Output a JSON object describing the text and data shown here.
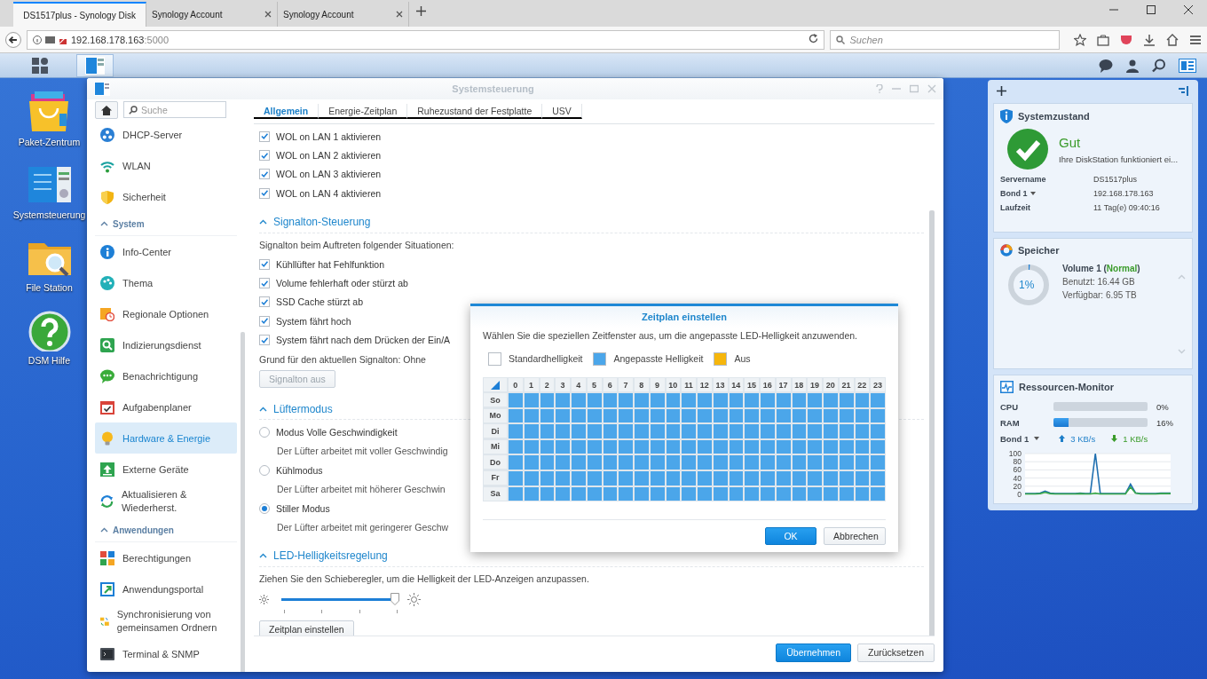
{
  "browser": {
    "tabs": [
      {
        "title": "DS1517plus - Synology Disk",
        "selected": true
      },
      {
        "title": "Synology Account",
        "selected": false
      },
      {
        "title": "Synology Account",
        "selected": false
      }
    ],
    "address": {
      "host": "192.168.178.163",
      "port": ":5000"
    },
    "search": {
      "placeholder": "Suchen"
    }
  },
  "taskbar": {
    "apps": [
      {
        "selected": true
      }
    ]
  },
  "desktop": {
    "icons": [
      {
        "label": "Paket-Zentrum"
      },
      {
        "label": "Systemsteuerung"
      },
      {
        "label": "File Station"
      },
      {
        "label": "DSM Hilfe"
      }
    ]
  },
  "window": {
    "title": "Systemsteuerung",
    "sidebar": {
      "search": {
        "placeholder": "Suche"
      },
      "items": [
        {
          "kind": "item",
          "label": "DHCP-Server",
          "selected": false
        },
        {
          "kind": "item",
          "label": "WLAN",
          "selected": false
        },
        {
          "kind": "item",
          "label": "Sicherheit",
          "selected": false
        },
        {
          "kind": "header",
          "label": "System",
          "expanded": true
        },
        {
          "kind": "item",
          "label": "Info-Center",
          "selected": false
        },
        {
          "kind": "item",
          "label": "Thema",
          "selected": false
        },
        {
          "kind": "item",
          "label": "Regionale Optionen",
          "selected": false
        },
        {
          "kind": "item",
          "label": "Indizierungsdienst",
          "selected": false
        },
        {
          "kind": "item",
          "label": "Benachrichtigung",
          "selected": false
        },
        {
          "kind": "item",
          "label": "Aufgabenplaner",
          "selected": false
        },
        {
          "kind": "item",
          "label": "Hardware & Energie",
          "selected": true
        },
        {
          "kind": "item",
          "label": "Externe Geräte",
          "selected": false
        },
        {
          "kind": "item",
          "label": "Aktualisieren & Wiederherst.",
          "selected": false
        },
        {
          "kind": "header",
          "label": "Anwendungen",
          "expanded": true
        },
        {
          "kind": "item",
          "label": "Berechtigungen",
          "selected": false
        },
        {
          "kind": "item",
          "label": "Anwendungsportal",
          "selected": false
        },
        {
          "kind": "item",
          "label": "Synchronisierung von gemeinsamen Ordnern",
          "selected": false
        },
        {
          "kind": "item",
          "label": "Terminal & SNMP",
          "selected": false
        }
      ]
    },
    "tabs": [
      {
        "label": "Allgemein",
        "selected": true
      },
      {
        "label": "Energie-Zeitplan",
        "selected": false
      },
      {
        "label": "Ruhezustand der Festplatte",
        "selected": false
      },
      {
        "label": "USV",
        "selected": false
      }
    ],
    "wol": [
      {
        "label": "WOL on LAN 1 aktivieren",
        "checked": true
      },
      {
        "label": "WOL on LAN 2 aktivieren",
        "checked": true
      },
      {
        "label": "WOL on LAN 3 aktivieren",
        "checked": true
      },
      {
        "label": "WOL on LAN 4 aktivieren",
        "checked": true
      }
    ],
    "sections": [
      {
        "title": "Signalton-Steuerung",
        "expanded": true,
        "description": "Signalton beim Auftreten folgender Situationen:",
        "options": [
          {
            "kind": "checkbox",
            "label": "Kühllüfter hat Fehlfunktion",
            "checked": true
          },
          {
            "kind": "checkbox",
            "label": "Volume fehlerhaft oder stürzt ab",
            "checked": true
          },
          {
            "kind": "checkbox",
            "label": "SSD Cache stürzt ab",
            "checked": true
          },
          {
            "kind": "checkbox",
            "label": "System fährt hoch",
            "checked": true
          },
          {
            "kind": "checkbox",
            "label": "System fährt nach dem Drücken der Ein/A",
            "checked": true
          }
        ],
        "status": "Grund für den aktuellen Signalton: Ohne",
        "button": {
          "label": "Signalton aus",
          "disabled": true
        }
      },
      {
        "title": "Lüftermodus",
        "expanded": true,
        "options": [
          {
            "kind": "radio",
            "label": "Modus Volle Geschwindigkeit",
            "selected": false,
            "note": "Der Lüfter arbeitet mit voller Geschwindig"
          },
          {
            "kind": "radio",
            "label": "Kühlmodus",
            "selected": false,
            "note": "Der Lüfter arbeitet mit höherer Geschwin"
          },
          {
            "kind": "radio",
            "label": "Stiller Modus",
            "selected": true,
            "note": "Der Lüfter arbeitet mit geringerer Geschw"
          }
        ]
      },
      {
        "title": "LED-Helligkeitsregelung",
        "expanded": true,
        "description": "Ziehen Sie den Schieberegler, um die Helligkeit der LED-Anzeigen anzupassen.",
        "slider": {
          "level": 1
        },
        "button": {
          "label": "Zeitplan einstellen",
          "disabled": false
        }
      }
    ],
    "footer": [
      {
        "label": "Übernehmen",
        "kind": "primary"
      },
      {
        "label": "Zurücksetzen",
        "kind": "secondary"
      }
    ]
  },
  "dialog": {
    "title": "Zeitplan einstellen",
    "description": "Wählen Sie die speziellen Zeitfenster aus, um die angepasste LED-Helligkeit anzuwenden.",
    "legend": [
      {
        "kind": "default",
        "label": "Standardhelligkeit",
        "color": "#ffffff"
      },
      {
        "kind": "custom",
        "label": "Angepasste Helligkeit",
        "color": "#4ba6ea"
      },
      {
        "kind": "off",
        "label": "Aus",
        "color": "#f6b60c"
      }
    ],
    "hours": [
      "0",
      "1",
      "2",
      "3",
      "4",
      "5",
      "6",
      "7",
      "8",
      "9",
      "10",
      "11",
      "12",
      "13",
      "14",
      "15",
      "16",
      "17",
      "18",
      "19",
      "20",
      "21",
      "22",
      "23"
    ],
    "days": [
      {
        "label": "So",
        "hours": [
          {
            "kind": "custom"
          },
          {
            "kind": "custom"
          },
          {
            "kind": "custom"
          },
          {
            "kind": "custom"
          },
          {
            "kind": "custom"
          },
          {
            "kind": "custom"
          },
          {
            "kind": "custom"
          },
          {
            "kind": "custom"
          },
          {
            "kind": "custom"
          },
          {
            "kind": "custom"
          },
          {
            "kind": "custom"
          },
          {
            "kind": "custom"
          },
          {
            "kind": "custom"
          },
          {
            "kind": "custom"
          },
          {
            "kind": "custom"
          },
          {
            "kind": "custom"
          },
          {
            "kind": "custom"
          },
          {
            "kind": "custom"
          },
          {
            "kind": "custom"
          },
          {
            "kind": "custom"
          },
          {
            "kind": "custom"
          },
          {
            "kind": "custom"
          },
          {
            "kind": "custom"
          },
          {
            "kind": "custom"
          }
        ]
      },
      {
        "label": "Mo",
        "hours": [
          {
            "kind": "custom"
          },
          {
            "kind": "custom"
          },
          {
            "kind": "custom"
          },
          {
            "kind": "custom"
          },
          {
            "kind": "custom"
          },
          {
            "kind": "custom"
          },
          {
            "kind": "custom"
          },
          {
            "kind": "custom"
          },
          {
            "kind": "custom"
          },
          {
            "kind": "custom"
          },
          {
            "kind": "custom"
          },
          {
            "kind": "custom"
          },
          {
            "kind": "custom"
          },
          {
            "kind": "custom"
          },
          {
            "kind": "custom"
          },
          {
            "kind": "custom"
          },
          {
            "kind": "custom"
          },
          {
            "kind": "custom"
          },
          {
            "kind": "custom"
          },
          {
            "kind": "custom"
          },
          {
            "kind": "custom"
          },
          {
            "kind": "custom"
          },
          {
            "kind": "custom"
          },
          {
            "kind": "custom"
          }
        ]
      },
      {
        "label": "Di",
        "hours": [
          {
            "kind": "custom"
          },
          {
            "kind": "custom"
          },
          {
            "kind": "custom"
          },
          {
            "kind": "custom"
          },
          {
            "kind": "custom"
          },
          {
            "kind": "custom"
          },
          {
            "kind": "custom"
          },
          {
            "kind": "custom"
          },
          {
            "kind": "custom"
          },
          {
            "kind": "custom"
          },
          {
            "kind": "custom"
          },
          {
            "kind": "custom"
          },
          {
            "kind": "custom"
          },
          {
            "kind": "custom"
          },
          {
            "kind": "custom"
          },
          {
            "kind": "custom"
          },
          {
            "kind": "custom"
          },
          {
            "kind": "custom"
          },
          {
            "kind": "custom"
          },
          {
            "kind": "custom"
          },
          {
            "kind": "custom"
          },
          {
            "kind": "custom"
          },
          {
            "kind": "custom"
          },
          {
            "kind": "custom"
          }
        ]
      },
      {
        "label": "Mi",
        "hours": [
          {
            "kind": "custom"
          },
          {
            "kind": "custom"
          },
          {
            "kind": "custom"
          },
          {
            "kind": "custom"
          },
          {
            "kind": "custom"
          },
          {
            "kind": "custom"
          },
          {
            "kind": "custom"
          },
          {
            "kind": "custom"
          },
          {
            "kind": "custom"
          },
          {
            "kind": "custom"
          },
          {
            "kind": "custom"
          },
          {
            "kind": "custom"
          },
          {
            "kind": "custom"
          },
          {
            "kind": "custom"
          },
          {
            "kind": "custom"
          },
          {
            "kind": "custom"
          },
          {
            "kind": "custom"
          },
          {
            "kind": "custom"
          },
          {
            "kind": "custom"
          },
          {
            "kind": "custom"
          },
          {
            "kind": "custom"
          },
          {
            "kind": "custom"
          },
          {
            "kind": "custom"
          },
          {
            "kind": "custom"
          }
        ]
      },
      {
        "label": "Do",
        "hours": [
          {
            "kind": "custom"
          },
          {
            "kind": "custom"
          },
          {
            "kind": "custom"
          },
          {
            "kind": "custom"
          },
          {
            "kind": "custom"
          },
          {
            "kind": "custom"
          },
          {
            "kind": "custom"
          },
          {
            "kind": "custom"
          },
          {
            "kind": "custom"
          },
          {
            "kind": "custom"
          },
          {
            "kind": "custom"
          },
          {
            "kind": "custom"
          },
          {
            "kind": "custom"
          },
          {
            "kind": "custom"
          },
          {
            "kind": "custom"
          },
          {
            "kind": "custom"
          },
          {
            "kind": "custom"
          },
          {
            "kind": "custom"
          },
          {
            "kind": "custom"
          },
          {
            "kind": "custom"
          },
          {
            "kind": "custom"
          },
          {
            "kind": "custom"
          },
          {
            "kind": "custom"
          },
          {
            "kind": "custom"
          }
        ]
      },
      {
        "label": "Fr",
        "hours": [
          {
            "kind": "custom"
          },
          {
            "kind": "custom"
          },
          {
            "kind": "custom"
          },
          {
            "kind": "custom"
          },
          {
            "kind": "custom"
          },
          {
            "kind": "custom"
          },
          {
            "kind": "custom"
          },
          {
            "kind": "custom"
          },
          {
            "kind": "custom"
          },
          {
            "kind": "custom"
          },
          {
            "kind": "custom"
          },
          {
            "kind": "custom"
          },
          {
            "kind": "custom"
          },
          {
            "kind": "custom"
          },
          {
            "kind": "custom"
          },
          {
            "kind": "custom"
          },
          {
            "kind": "custom"
          },
          {
            "kind": "custom"
          },
          {
            "kind": "custom"
          },
          {
            "kind": "custom"
          },
          {
            "kind": "custom"
          },
          {
            "kind": "custom"
          },
          {
            "kind": "custom"
          },
          {
            "kind": "custom"
          }
        ]
      },
      {
        "label": "Sa",
        "hours": [
          {
            "kind": "custom"
          },
          {
            "kind": "custom"
          },
          {
            "kind": "custom"
          },
          {
            "kind": "custom"
          },
          {
            "kind": "custom"
          },
          {
            "kind": "custom"
          },
          {
            "kind": "custom"
          },
          {
            "kind": "custom"
          },
          {
            "kind": "custom"
          },
          {
            "kind": "custom"
          },
          {
            "kind": "custom"
          },
          {
            "kind": "custom"
          },
          {
            "kind": "custom"
          },
          {
            "kind": "custom"
          },
          {
            "kind": "custom"
          },
          {
            "kind": "custom"
          },
          {
            "kind": "custom"
          },
          {
            "kind": "custom"
          },
          {
            "kind": "custom"
          },
          {
            "kind": "custom"
          },
          {
            "kind": "custom"
          },
          {
            "kind": "custom"
          },
          {
            "kind": "custom"
          },
          {
            "kind": "custom"
          }
        ]
      }
    ],
    "buttons": [
      {
        "label": "OK",
        "kind": "primary"
      },
      {
        "label": "Abbrechen",
        "kind": "secondary"
      }
    ]
  },
  "widgets": {
    "system": {
      "title": "Systemzustand",
      "status": "Gut",
      "message": "Ihre DiskStation funktioniert ei...",
      "rows": [
        {
          "kind": "plain",
          "label": "Servername",
          "value": "DS1517plus"
        },
        {
          "kind": "dropdown",
          "label": "Bond 1",
          "value": "192.168.178.163"
        },
        {
          "kind": "plain",
          "label": "Laufzeit",
          "value": "11 Tag(e) 09:40:16"
        }
      ]
    },
    "storage": {
      "title": "Speicher",
      "percent": "1%",
      "level": 0.01,
      "volume": "Volume 1 (**Normal**)",
      "used": "Benutzt: 16.44 GB",
      "free": "Verfügbar: 6.95 TB"
    },
    "resources": {
      "title": "Ressourcen-Monitor",
      "meters": [
        {
          "label": "CPU",
          "level": 0,
          "reading": "0%"
        },
        {
          "label": "RAM",
          "level": 0.16,
          "reading": "16%"
        }
      ],
      "network": {
        "label": "Bond 1",
        "upload": "3 KB/s",
        "download": "1 KB/s"
      },
      "chart_data": {
        "type": "line",
        "grid": true,
        "ylim": [
          0,
          100
        ],
        "yticks": [
          0,
          20,
          40,
          60,
          80,
          100
        ],
        "series": [
          {
            "color": "#1f6fb0",
            "values": [
              2,
              2,
              2,
              3,
              8,
              3,
              2,
              2,
              2,
              2,
              2,
              3,
              2,
              2,
              100,
              2,
              2,
              2,
              2,
              2,
              2,
              25,
              4,
              2,
              2,
              2,
              2,
              3,
              3,
              3
            ]
          },
          {
            "color": "#3aa84a",
            "values": [
              1,
              1,
              1,
              2,
              5,
              2,
              1,
              1,
              1,
              1,
              1,
              2,
              1,
              1,
              3,
              1,
              1,
              1,
              1,
              1,
              1,
              18,
              3,
              1,
              1,
              1,
              1,
              2,
              2,
              2
            ]
          }
        ]
      }
    }
  }
}
